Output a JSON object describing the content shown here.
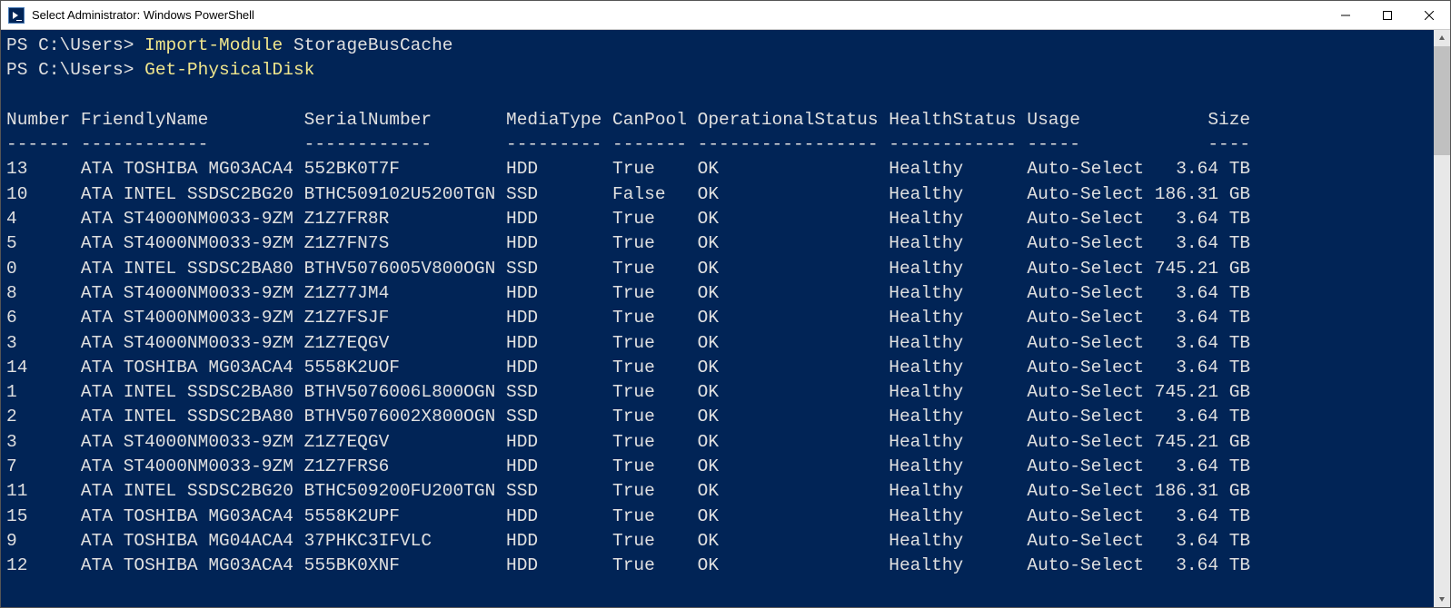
{
  "window": {
    "title": "Select Administrator: Windows PowerShell"
  },
  "prompt": "PS C:\\Users> ",
  "commands": [
    {
      "cmdlet": "Import-Module",
      "arg": "StorageBusCache"
    },
    {
      "cmdlet": "Get-PhysicalDisk",
      "arg": ""
    }
  ],
  "table": {
    "columns": [
      "Number",
      "FriendlyName",
      "SerialNumber",
      "MediaType",
      "CanPool",
      "OperationalStatus",
      "HealthStatus",
      "Usage",
      "Size"
    ],
    "separators": [
      "------",
      "------------",
      "------------",
      "---------",
      "-------",
      "-----------------",
      "------------",
      "-----",
      "----"
    ],
    "rows": [
      {
        "Number": "13",
        "FriendlyName": "ATA TOSHIBA MG03ACA4",
        "SerialNumber": "552BK0T7F",
        "MediaType": "HDD",
        "CanPool": "True",
        "OperationalStatus": "OK",
        "HealthStatus": "Healthy",
        "Usage": "Auto-Select",
        "Size": "3.64 TB"
      },
      {
        "Number": "10",
        "FriendlyName": "ATA INTEL SSDSC2BG20",
        "SerialNumber": "BTHC509102U5200TGN",
        "MediaType": "SSD",
        "CanPool": "False",
        "OperationalStatus": "OK",
        "HealthStatus": "Healthy",
        "Usage": "Auto-Select",
        "Size": "186.31 GB"
      },
      {
        "Number": "4",
        "FriendlyName": "ATA ST4000NM0033-9ZM",
        "SerialNumber": "Z1Z7FR8R",
        "MediaType": "HDD",
        "CanPool": "True",
        "OperationalStatus": "OK",
        "HealthStatus": "Healthy",
        "Usage": "Auto-Select",
        "Size": "3.64 TB"
      },
      {
        "Number": "5",
        "FriendlyName": "ATA ST4000NM0033-9ZM",
        "SerialNumber": "Z1Z7FN7S",
        "MediaType": "HDD",
        "CanPool": "True",
        "OperationalStatus": "OK",
        "HealthStatus": "Healthy",
        "Usage": "Auto-Select",
        "Size": "3.64 TB"
      },
      {
        "Number": "0",
        "FriendlyName": "ATA INTEL SSDSC2BA80",
        "SerialNumber": "BTHV5076005V800OGN",
        "MediaType": "SSD",
        "CanPool": "True",
        "OperationalStatus": "OK",
        "HealthStatus": "Healthy",
        "Usage": "Auto-Select",
        "Size": "745.21 GB"
      },
      {
        "Number": "8",
        "FriendlyName": "ATA ST4000NM0033-9ZM",
        "SerialNumber": "Z1Z77JM4",
        "MediaType": "HDD",
        "CanPool": "True",
        "OperationalStatus": "OK",
        "HealthStatus": "Healthy",
        "Usage": "Auto-Select",
        "Size": "3.64 TB"
      },
      {
        "Number": "6",
        "FriendlyName": "ATA ST4000NM0033-9ZM",
        "SerialNumber": "Z1Z7FSJF",
        "MediaType": "HDD",
        "CanPool": "True",
        "OperationalStatus": "OK",
        "HealthStatus": "Healthy",
        "Usage": "Auto-Select",
        "Size": "3.64 TB"
      },
      {
        "Number": "3",
        "FriendlyName": "ATA ST4000NM0033-9ZM",
        "SerialNumber": "Z1Z7EQGV",
        "MediaType": "HDD",
        "CanPool": "True",
        "OperationalStatus": "OK",
        "HealthStatus": "Healthy",
        "Usage": "Auto-Select",
        "Size": "3.64 TB"
      },
      {
        "Number": "14",
        "FriendlyName": "ATA TOSHIBA MG03ACA4",
        "SerialNumber": "5558K2UOF",
        "MediaType": "HDD",
        "CanPool": "True",
        "OperationalStatus": "OK",
        "HealthStatus": "Healthy",
        "Usage": "Auto-Select",
        "Size": "3.64 TB"
      },
      {
        "Number": "1",
        "FriendlyName": "ATA INTEL SSDSC2BA80",
        "SerialNumber": "BTHV5076006L800OGN",
        "MediaType": "SSD",
        "CanPool": "True",
        "OperationalStatus": "OK",
        "HealthStatus": "Healthy",
        "Usage": "Auto-Select",
        "Size": "745.21 GB"
      },
      {
        "Number": "2",
        "FriendlyName": "ATA INTEL SSDSC2BA80",
        "SerialNumber": "BTHV5076002X800OGN",
        "MediaType": "SSD",
        "CanPool": "True",
        "OperationalStatus": "OK",
        "HealthStatus": "Healthy",
        "Usage": "Auto-Select",
        "Size": "3.64 TB"
      },
      {
        "Number": "3",
        "FriendlyName": "ATA ST4000NM0033-9ZM",
        "SerialNumber": "Z1Z7EQGV",
        "MediaType": "HDD",
        "CanPool": "True",
        "OperationalStatus": "OK",
        "HealthStatus": "Healthy",
        "Usage": "Auto-Select",
        "Size": "745.21 GB"
      },
      {
        "Number": "7",
        "FriendlyName": "ATA ST4000NM0033-9ZM",
        "SerialNumber": "Z1Z7FRS6",
        "MediaType": "HDD",
        "CanPool": "True",
        "OperationalStatus": "OK",
        "HealthStatus": "Healthy",
        "Usage": "Auto-Select",
        "Size": "3.64 TB"
      },
      {
        "Number": "11",
        "FriendlyName": "ATA INTEL SSDSC2BG20",
        "SerialNumber": "BTHC509200FU200TGN",
        "MediaType": "SSD",
        "CanPool": "True",
        "OperationalStatus": "OK",
        "HealthStatus": "Healthy",
        "Usage": "Auto-Select",
        "Size": "186.31 GB"
      },
      {
        "Number": "15",
        "FriendlyName": "ATA TOSHIBA MG03ACA4",
        "SerialNumber": "5558K2UPF",
        "MediaType": "HDD",
        "CanPool": "True",
        "OperationalStatus": "OK",
        "HealthStatus": "Healthy",
        "Usage": "Auto-Select",
        "Size": "3.64 TB"
      },
      {
        "Number": "9",
        "FriendlyName": "ATA TOSHIBA MG04ACA4",
        "SerialNumber": "37PHKC3IFVLC",
        "MediaType": "HDD",
        "CanPool": "True",
        "OperationalStatus": "OK",
        "HealthStatus": "Healthy",
        "Usage": "Auto-Select",
        "Size": "3.64 TB"
      },
      {
        "Number": "12",
        "FriendlyName": "ATA TOSHIBA MG03ACA4",
        "SerialNumber": "555BK0XNF",
        "MediaType": "HDD",
        "CanPool": "True",
        "OperationalStatus": "OK",
        "HealthStatus": "Healthy",
        "Usage": "Auto-Select",
        "Size": "3.64 TB"
      }
    ]
  }
}
